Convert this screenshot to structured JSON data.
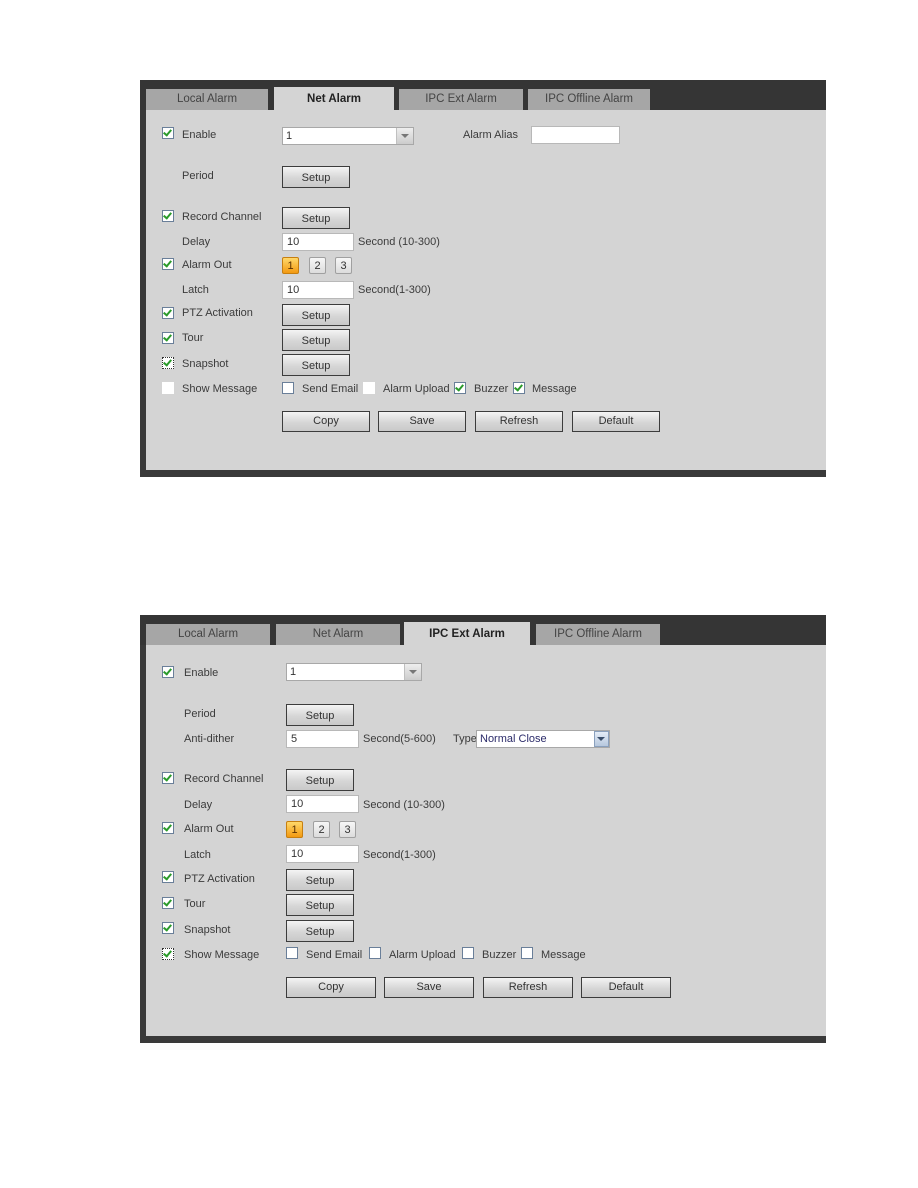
{
  "panels": [
    {
      "tabs": [
        "Local Alarm",
        "Net Alarm",
        "IPC Ext Alarm",
        "IPC Offline Alarm"
      ],
      "active_tab": "Net Alarm",
      "enable": {
        "label": "Enable",
        "checked": true,
        "channel_value": "1"
      },
      "alarm_alias": {
        "label": "Alarm Alias",
        "value": ""
      },
      "period": {
        "label": "Period",
        "button": "Setup"
      },
      "record_channel": {
        "label": "Record Channel",
        "checked": true,
        "button": "Setup"
      },
      "delay": {
        "label": "Delay",
        "value": "10",
        "unit": "Second (10-300)"
      },
      "alarm_out": {
        "label": "Alarm Out",
        "checked": true,
        "channels": [
          "1",
          "2",
          "3"
        ],
        "active_channel": "1"
      },
      "latch": {
        "label": "Latch",
        "value": "10",
        "unit": "Second(1-300)"
      },
      "ptz_activation": {
        "label": "PTZ Activation",
        "checked": true,
        "button": "Setup"
      },
      "tour": {
        "label": "Tour",
        "checked": true,
        "button": "Setup"
      },
      "snapshot": {
        "label": "Snapshot",
        "checked": true,
        "button": "Setup"
      },
      "show_message": {
        "label": "Show Message",
        "checked": false
      },
      "options": [
        {
          "label": "Send Email",
          "checked": false
        },
        {
          "label": "Alarm Upload",
          "checked": false
        },
        {
          "label": "Buzzer",
          "checked": true
        },
        {
          "label": "Message",
          "checked": true
        }
      ],
      "actions": [
        "Copy",
        "Save",
        "Refresh",
        "Default"
      ]
    },
    {
      "tabs": [
        "Local Alarm",
        "Net Alarm",
        "IPC Ext Alarm",
        "IPC Offline Alarm"
      ],
      "active_tab": "IPC Ext Alarm",
      "enable": {
        "label": "Enable",
        "checked": true,
        "channel_value": "1"
      },
      "period": {
        "label": "Period",
        "button": "Setup"
      },
      "anti_dither": {
        "label": "Anti-dither",
        "value": "5",
        "unit": "Second(5-600)"
      },
      "type": {
        "label": "Type",
        "value": "Normal Close"
      },
      "record_channel": {
        "label": "Record Channel",
        "checked": true,
        "button": "Setup"
      },
      "delay": {
        "label": "Delay",
        "value": "10",
        "unit": "Second (10-300)"
      },
      "alarm_out": {
        "label": "Alarm Out",
        "checked": true,
        "channels": [
          "1",
          "2",
          "3"
        ],
        "active_channel": "1"
      },
      "latch": {
        "label": "Latch",
        "value": "10",
        "unit": "Second(1-300)"
      },
      "ptz_activation": {
        "label": "PTZ Activation",
        "checked": true,
        "button": "Setup"
      },
      "tour": {
        "label": "Tour",
        "checked": true,
        "button": "Setup"
      },
      "snapshot": {
        "label": "Snapshot",
        "checked": true,
        "button": "Setup"
      },
      "show_message": {
        "label": "Show Message",
        "checked": true
      },
      "options": [
        {
          "label": "Send Email",
          "checked": false
        },
        {
          "label": "Alarm Upload",
          "checked": false
        },
        {
          "label": "Buzzer",
          "checked": false
        },
        {
          "label": "Message",
          "checked": false
        }
      ],
      "actions": [
        "Copy",
        "Save",
        "Refresh",
        "Default"
      ]
    }
  ],
  "colors": {
    "frame": "#353535",
    "content_bg": "#d4d4d4",
    "tab_inactive": "#a6a6a6",
    "active_channel": "#f39a12",
    "check": "#2a9a2a"
  }
}
